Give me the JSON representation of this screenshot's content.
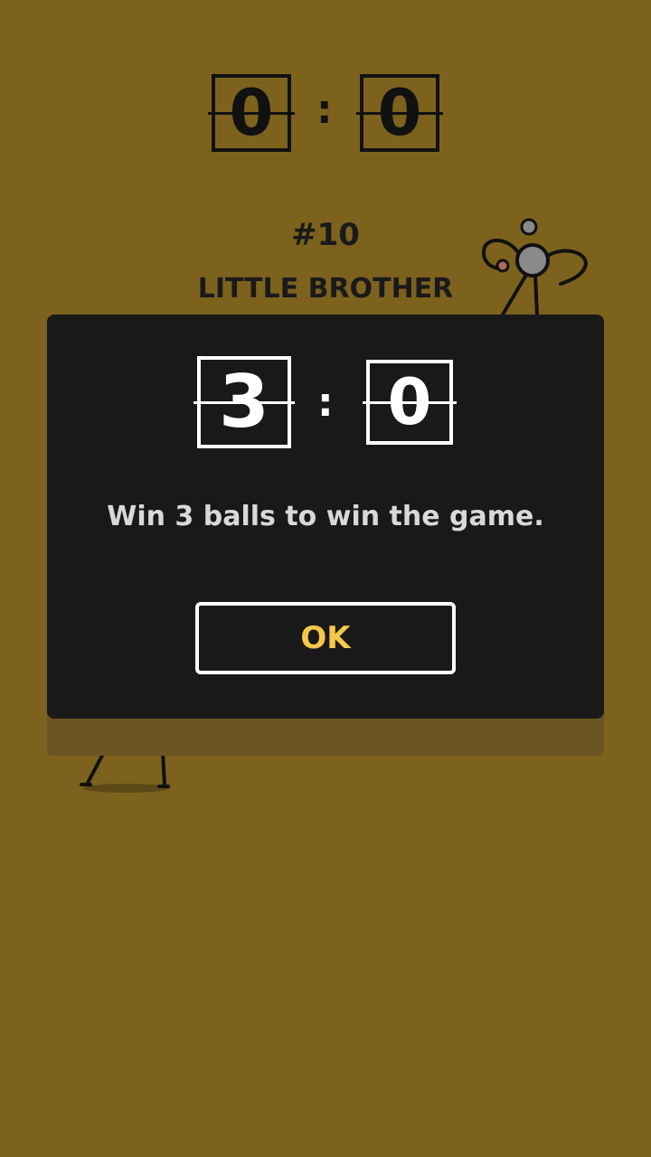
{
  "scoreboard": {
    "player_score": "0",
    "separator": ":",
    "opponent_score": "0"
  },
  "level": {
    "number": "#10",
    "opponent_name": "LITTLE BROTHER"
  },
  "dialog": {
    "player_score": "3",
    "separator": ":",
    "opponent_score": "0",
    "message": "Win 3 balls to win the game.",
    "ok_label": "OK"
  },
  "colors": {
    "background": "#7d621e",
    "dialog_bg": "#191919",
    "ok_text": "#f5c84a"
  }
}
